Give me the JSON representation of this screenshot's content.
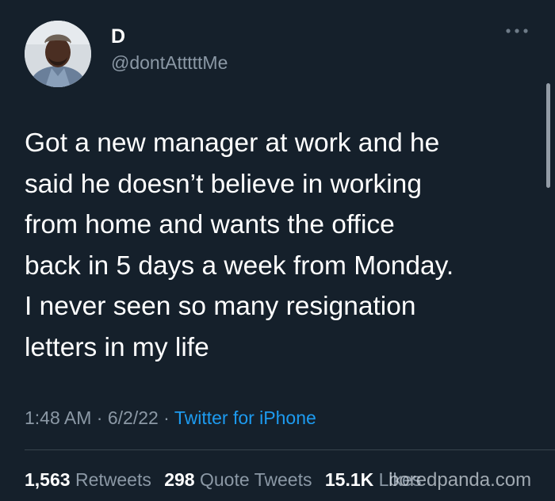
{
  "tweet": {
    "display_name": "D",
    "handle": "@dontAtttttMe",
    "text": "Got a new manager at work and he\nsaid he doesn’t believe in working\nfrom home and wants the office\nback in 5 days a week from Monday.\nI never seen so many resignation\nletters in my life",
    "time": "1:48 AM",
    "date": "6/2/22",
    "separator": " · ",
    "source": "Twitter for iPhone"
  },
  "stats": {
    "retweets_count": "1,563",
    "retweets_label": "Retweets",
    "quotes_count": "298",
    "quotes_label": "Quote Tweets",
    "likes_count": "15.1K",
    "likes_label": "Likes"
  },
  "watermark": "boredpanda.com",
  "colors": {
    "background": "#15202b",
    "primary_text": "#ffffff",
    "secondary_text": "#8b98a5",
    "link": "#1d9bf0",
    "divider": "#38444d"
  },
  "icons": {
    "more": "more-horizontal-icon"
  }
}
